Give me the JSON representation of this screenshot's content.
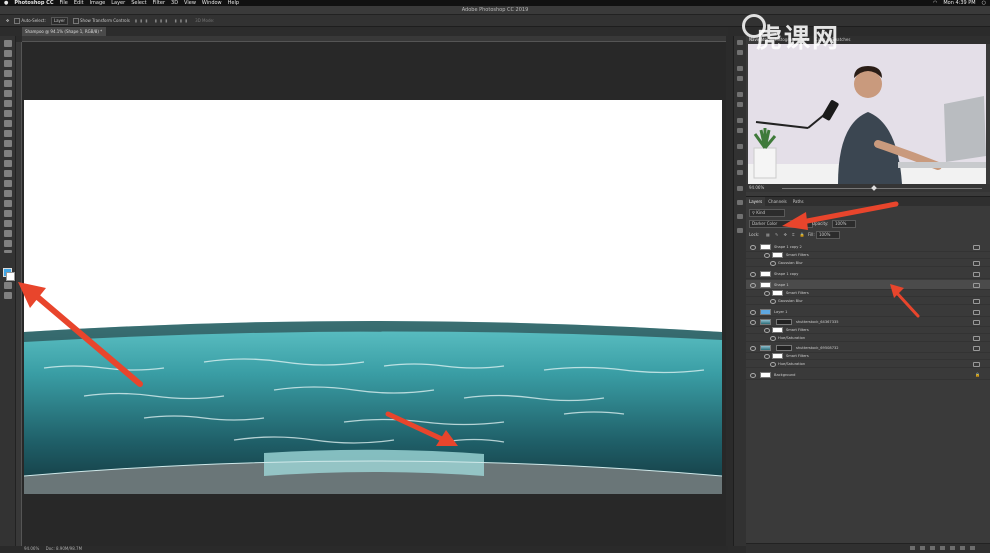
{
  "menubar": {
    "apple": "",
    "items": [
      "Photoshop CC",
      "File",
      "Edit",
      "Image",
      "Layer",
      "Select",
      "Filter",
      "3D",
      "View",
      "Window",
      "Help"
    ],
    "clock": "Mon 4:39 PM"
  },
  "window": {
    "title": "Adobe Photoshop CC 2019"
  },
  "options_bar": {
    "auto_select_label": "Auto-Select:",
    "auto_select_value": "Layer",
    "transform_label": "Show Transform Controls",
    "mode_label": "3D Mode:"
  },
  "document": {
    "tab_label": "Shampoo @ 94.1% (Shape 1, RGB/8) *",
    "status_zoom": "94.06%",
    "status_doc": "Doc: 8.90M/98.7M"
  },
  "navigator": {
    "tabs": [
      "Navigator",
      "Histogram",
      "Info",
      "Color",
      "Swatches"
    ],
    "zoom": "94.06%"
  },
  "layers_panel": {
    "tabs": [
      "Layers",
      "Channels",
      "Paths"
    ],
    "kind_filter": "Kind",
    "blend_mode": "Darker Color",
    "opacity_label": "Opacity:",
    "opacity_value": "100%",
    "lock_label": "Lock:",
    "fill_label": "Fill:",
    "fill_value": "100%",
    "layers": [
      {
        "name": "Shape 1 copy 2",
        "kind": "shape",
        "indent": 0,
        "selected": false
      },
      {
        "name": "Smart Filters",
        "kind": "filters",
        "indent": 1,
        "selected": false
      },
      {
        "name": "Gaussian Blur",
        "kind": "filter",
        "indent": 2,
        "selected": false
      },
      {
        "name": "Shape 1 copy",
        "kind": "shape",
        "indent": 0,
        "selected": false
      },
      {
        "name": "Shape 1",
        "kind": "shape",
        "indent": 0,
        "selected": true
      },
      {
        "name": "Smart Filters",
        "kind": "filters",
        "indent": 1,
        "selected": false
      },
      {
        "name": "Gaussian Blur",
        "kind": "filter",
        "indent": 2,
        "selected": false
      },
      {
        "name": "Layer 1",
        "kind": "pixel-blue",
        "indent": 0,
        "selected": false
      },
      {
        "name": "shutterstock_64367335",
        "kind": "smart",
        "indent": 0,
        "selected": false
      },
      {
        "name": "Smart Filters",
        "kind": "filters",
        "indent": 1,
        "selected": false
      },
      {
        "name": "Hue/Saturation",
        "kind": "filter",
        "indent": 2,
        "selected": false
      },
      {
        "name": "shutterstock_69508732",
        "kind": "smart",
        "indent": 0,
        "selected": false
      },
      {
        "name": "Smart Filters",
        "kind": "filters",
        "indent": 1,
        "selected": false
      },
      {
        "name": "Hue/Saturation",
        "kind": "filter",
        "indent": 2,
        "selected": false
      },
      {
        "name": "Background",
        "kind": "background",
        "indent": 0,
        "selected": false
      }
    ]
  },
  "watermark": {
    "text": "虎课网"
  },
  "colors": {
    "foreground": "#41a6e6",
    "background": "#ffffff",
    "arrow": "#e8452c",
    "panel_bg": "#3a3a3a"
  }
}
